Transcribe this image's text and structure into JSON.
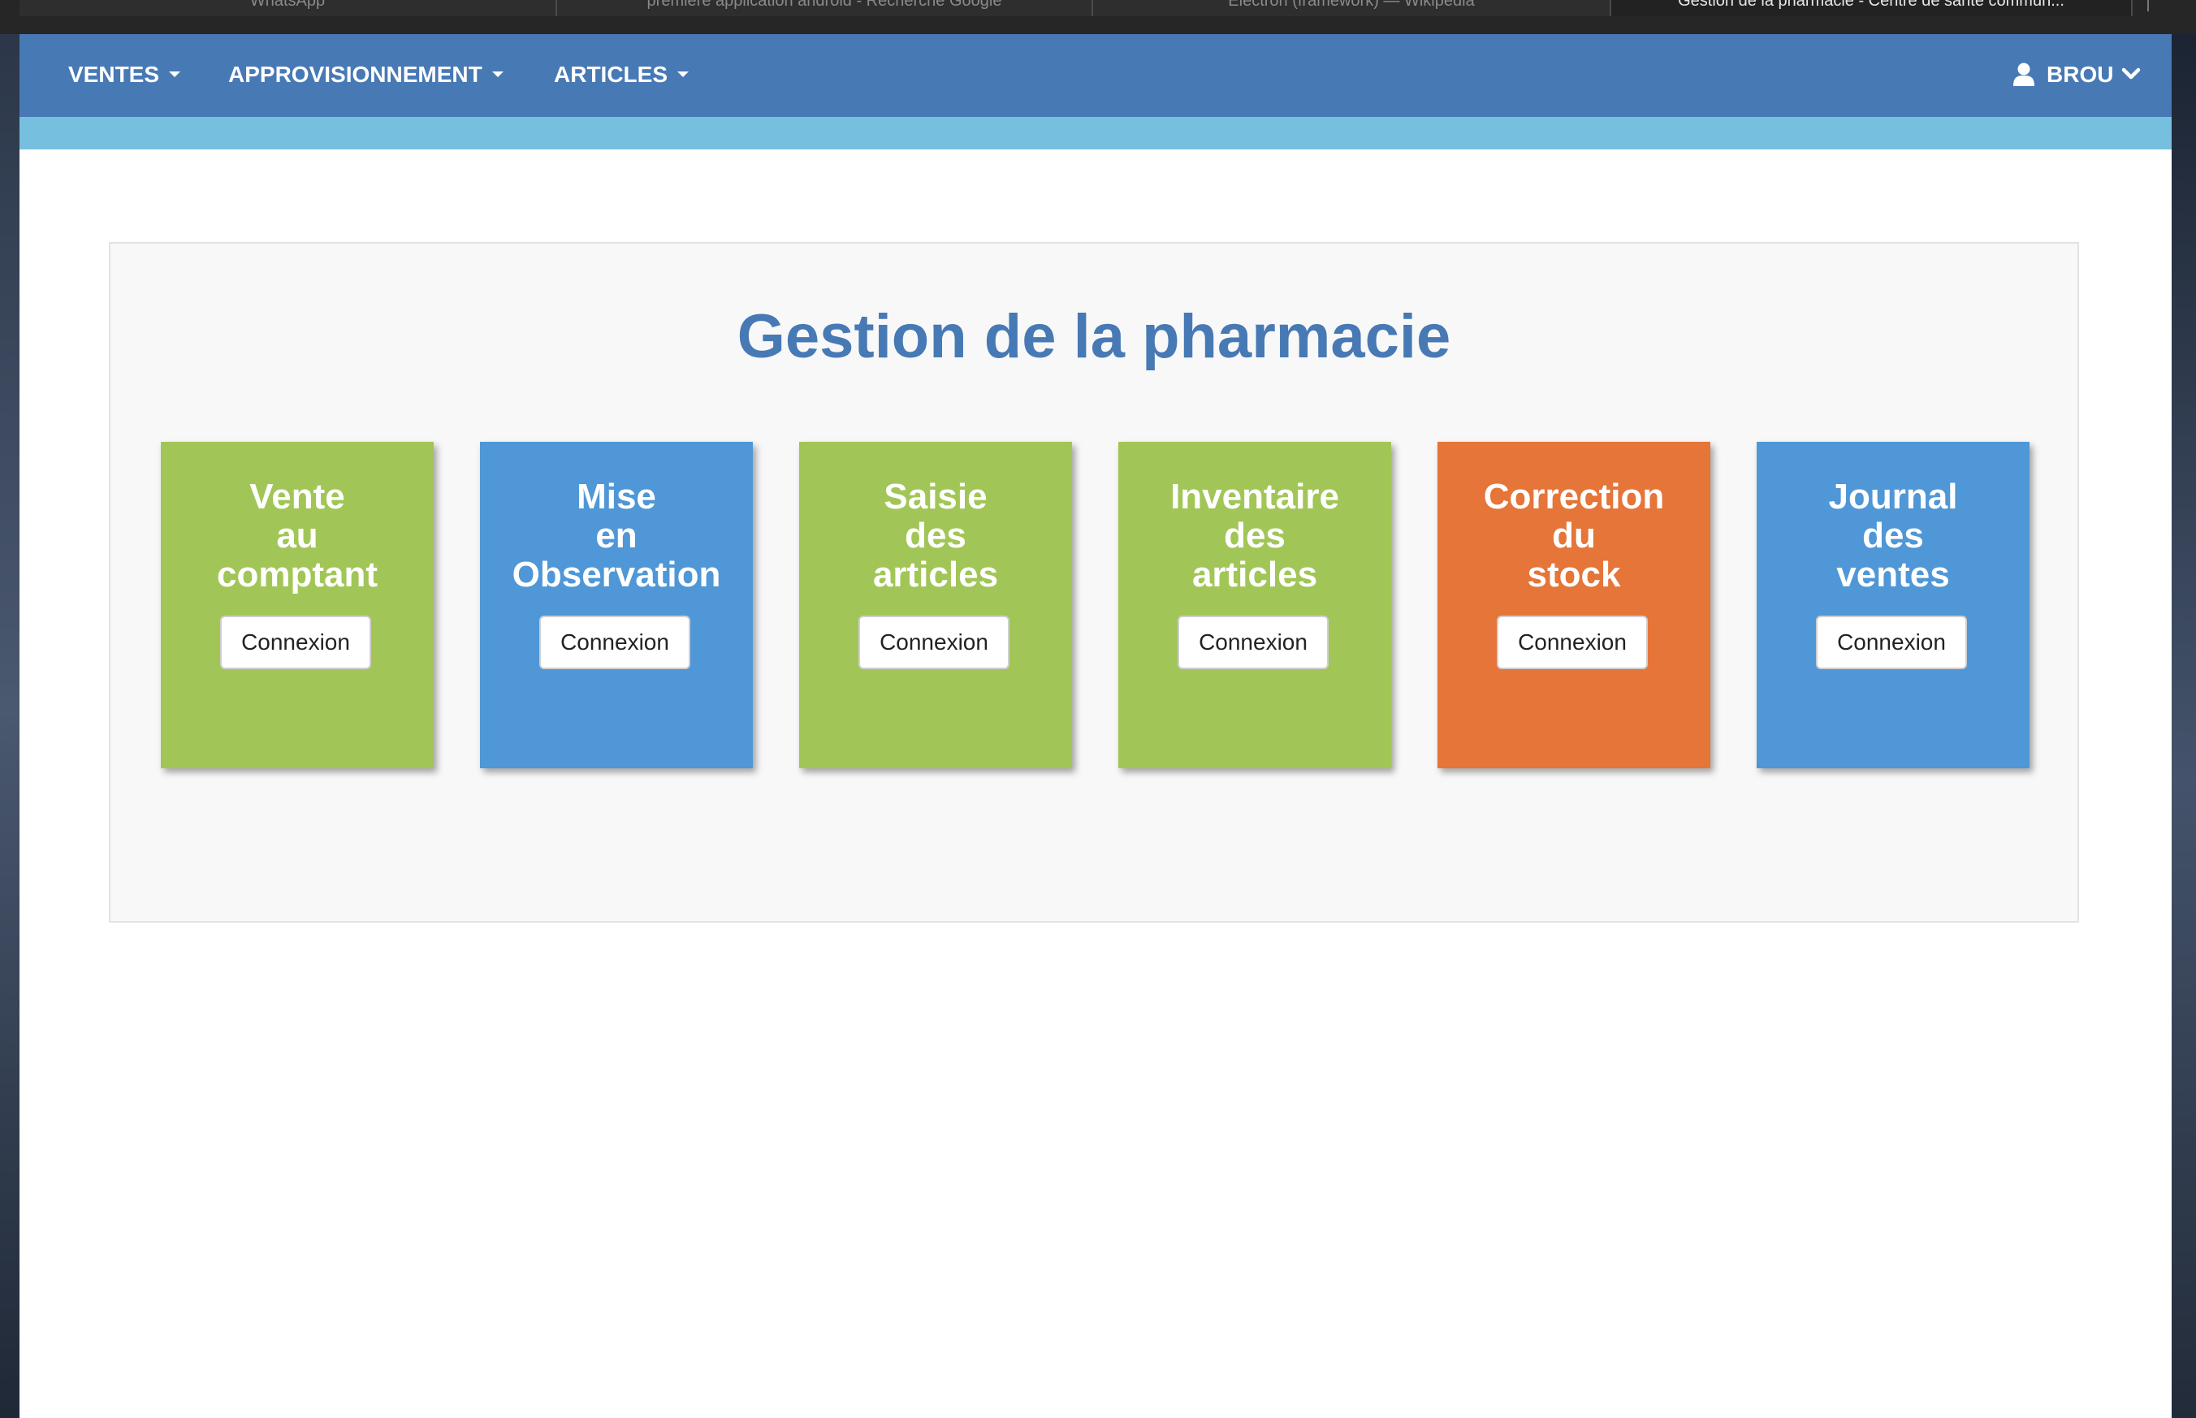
{
  "browser": {
    "tabs": [
      {
        "label": "WhatsApp"
      },
      {
        "label": "première application android - Recherche Google"
      },
      {
        "label": "Electron (framework) — Wikipédia"
      },
      {
        "label": "Gestion de la pharmacie - Centre de santé commun..."
      }
    ]
  },
  "navbar": {
    "menus": [
      {
        "label": "VENTES"
      },
      {
        "label": "APPROVISIONNEMENT"
      },
      {
        "label": "ARTICLES"
      }
    ],
    "user": {
      "label": "BROU",
      "icon": "user-icon"
    }
  },
  "main": {
    "title": "Gestion de la pharmacie",
    "cards": [
      {
        "lines": [
          "Vente",
          "au",
          "comptant"
        ],
        "button": "Connexion",
        "color": "#a1c657"
      },
      {
        "lines": [
          "Mise",
          "en",
          "Observation"
        ],
        "button": "Connexion",
        "color": "#4f97d6"
      },
      {
        "lines": [
          "Saisie",
          "des",
          "articles"
        ],
        "button": "Connexion",
        "color": "#a1c657"
      },
      {
        "lines": [
          "Inventaire",
          "des",
          "articles"
        ],
        "button": "Connexion",
        "color": "#a1c657"
      },
      {
        "lines": [
          "Correction",
          "du",
          "stock"
        ],
        "button": "Connexion",
        "color": "#e57538"
      },
      {
        "lines": [
          "Journal",
          "des",
          "ventes"
        ],
        "button": "Connexion",
        "color": "#4f97d6"
      }
    ]
  },
  "colors": {
    "navbar": "#4779b5",
    "subbar": "#77bfdf",
    "title": "#4779b5"
  }
}
